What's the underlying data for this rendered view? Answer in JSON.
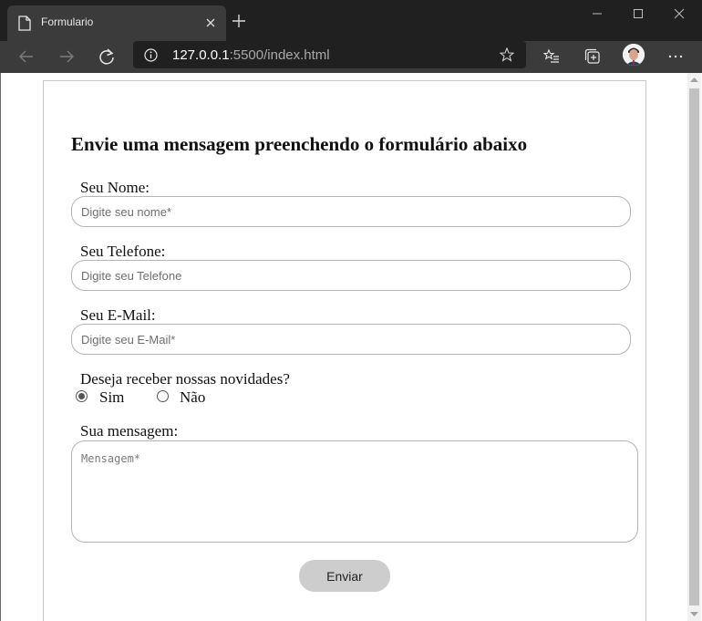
{
  "browser": {
    "tab_title": "Formulario",
    "address_host": "127.0.0.1",
    "address_rest": ":5500/index.html"
  },
  "icons": {
    "page": "page-icon",
    "close": "close-icon",
    "new_tab": "plus-icon",
    "back": "arrow-left-icon",
    "forward": "arrow-right-icon",
    "reload": "reload-icon",
    "info": "info-icon",
    "favorite": "star-icon",
    "favorites_list": "favorites-icon",
    "collections": "collections-icon",
    "menu": "more-icon"
  },
  "colors": {
    "titlebar": "#202020",
    "toolbar": "#3b3b3b",
    "button": "#cdcdcd",
    "field_border": "#b5b5b5"
  },
  "form": {
    "heading": "Envie uma mensagem preenchendo o formulário abaixo",
    "name_label": "Seu Nome:",
    "name_placeholder": "Digite seu nome*",
    "phone_label": "Seu Telefone:",
    "phone_placeholder": "Digite seu Telefone",
    "email_label": "Seu E-Mail:",
    "email_placeholder": "Digite seu E-Mail*",
    "news_label": "Deseja receber nossas novidades?",
    "option_yes": "Sim",
    "option_no": "Não",
    "selected_option": "Sim",
    "message_label": "Sua mensagem:",
    "message_placeholder": "Mensagem*",
    "submit_label": "Enviar"
  }
}
